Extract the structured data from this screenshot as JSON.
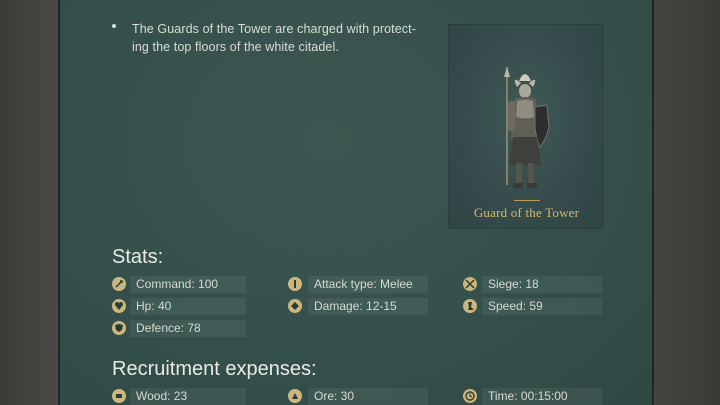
{
  "description": {
    "text": "The Guards of the Tower are charged with protect-ing the top floors of the white citadel."
  },
  "unit": {
    "name": "Guard of the Tower"
  },
  "stats": {
    "title": "Stats:",
    "command": "Command: 100",
    "attack_type": "Attack type: Melee",
    "siege": "Siege: 18",
    "hp": "Hp: 40",
    "damage": "Damage: 12-15",
    "speed": "Speed: 59",
    "defence": "Defence: 78"
  },
  "recruitment": {
    "title": "Recruitment expenses:",
    "wood": "Wood: 23",
    "ore": "Ore: 30",
    "time": "Time: 00:15:00"
  },
  "colors": {
    "panel": "#35504b",
    "accent_gold": "#d8b86b",
    "text": "#d9ddd7"
  }
}
